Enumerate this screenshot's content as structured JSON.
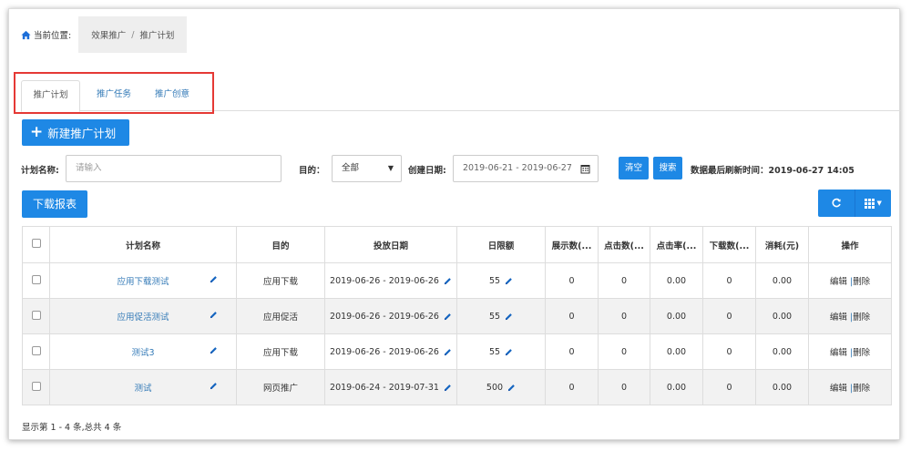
{
  "breadcrumb": {
    "label": "当前位置:",
    "parent": "效果推广",
    "separator": "/",
    "current": "推广计划"
  },
  "tabs": [
    {
      "label": "推广计划",
      "active": true
    },
    {
      "label": "推广任务",
      "active": false
    },
    {
      "label": "推广创意",
      "active": false
    }
  ],
  "new_button": {
    "label": "新建推广计划",
    "icon": "plus-icon"
  },
  "filters": {
    "name_label": "计划名称:",
    "name_placeholder": "请输入",
    "purpose_label": "目的：",
    "purpose_value": "全部",
    "created_label": "创建日期:",
    "date_range": "2019-06-21 - 2019-06-27",
    "clear_label": "清空",
    "search_label": "搜索",
    "refresh_text": "数据最后刷新时间：2019-06-27 14:05"
  },
  "download_label": "下载报表",
  "toolbar": {
    "refresh_icon": "refresh-icon",
    "columns_icon": "grid-icon"
  },
  "table": {
    "headers": [
      "计划名称",
      "目的",
      "投放日期",
      "日限额",
      "展示数(...",
      "点击数(...",
      "点击率(...",
      "下载数(...",
      "消耗(元)",
      "操作"
    ],
    "rows": [
      {
        "name": "应用下载测试",
        "purpose": "应用下载",
        "dates": "2019-06-26 - 2019-06-26",
        "limit": "55",
        "impressions": "0",
        "clicks": "0",
        "ctr": "0.00",
        "downloads": "0",
        "cost": "0.00",
        "edit": "编辑",
        "delete": "删除"
      },
      {
        "name": "应用促活测试",
        "purpose": "应用促活",
        "dates": "2019-06-26 - 2019-06-26",
        "limit": "55",
        "impressions": "0",
        "clicks": "0",
        "ctr": "0.00",
        "downloads": "0",
        "cost": "0.00",
        "edit": "编辑",
        "delete": "删除"
      },
      {
        "name": "测试3",
        "purpose": "应用下载",
        "dates": "2019-06-26 - 2019-06-26",
        "limit": "55",
        "impressions": "0",
        "clicks": "0",
        "ctr": "0.00",
        "downloads": "0",
        "cost": "0.00",
        "edit": "编辑",
        "delete": "删除"
      },
      {
        "name": "测试",
        "purpose": "网页推广",
        "dates": "2019-06-24 - 2019-07-31",
        "limit": "500",
        "impressions": "0",
        "clicks": "0",
        "ctr": "0.00",
        "downloads": "0",
        "cost": "0.00",
        "edit": "编辑",
        "delete": "删除"
      }
    ]
  },
  "footer": "显示第 1 - 4 条,总共 4 条",
  "colors": {
    "primary": "#1e88e5",
    "link": "#337ab7",
    "highlight_box": "#e53935"
  }
}
